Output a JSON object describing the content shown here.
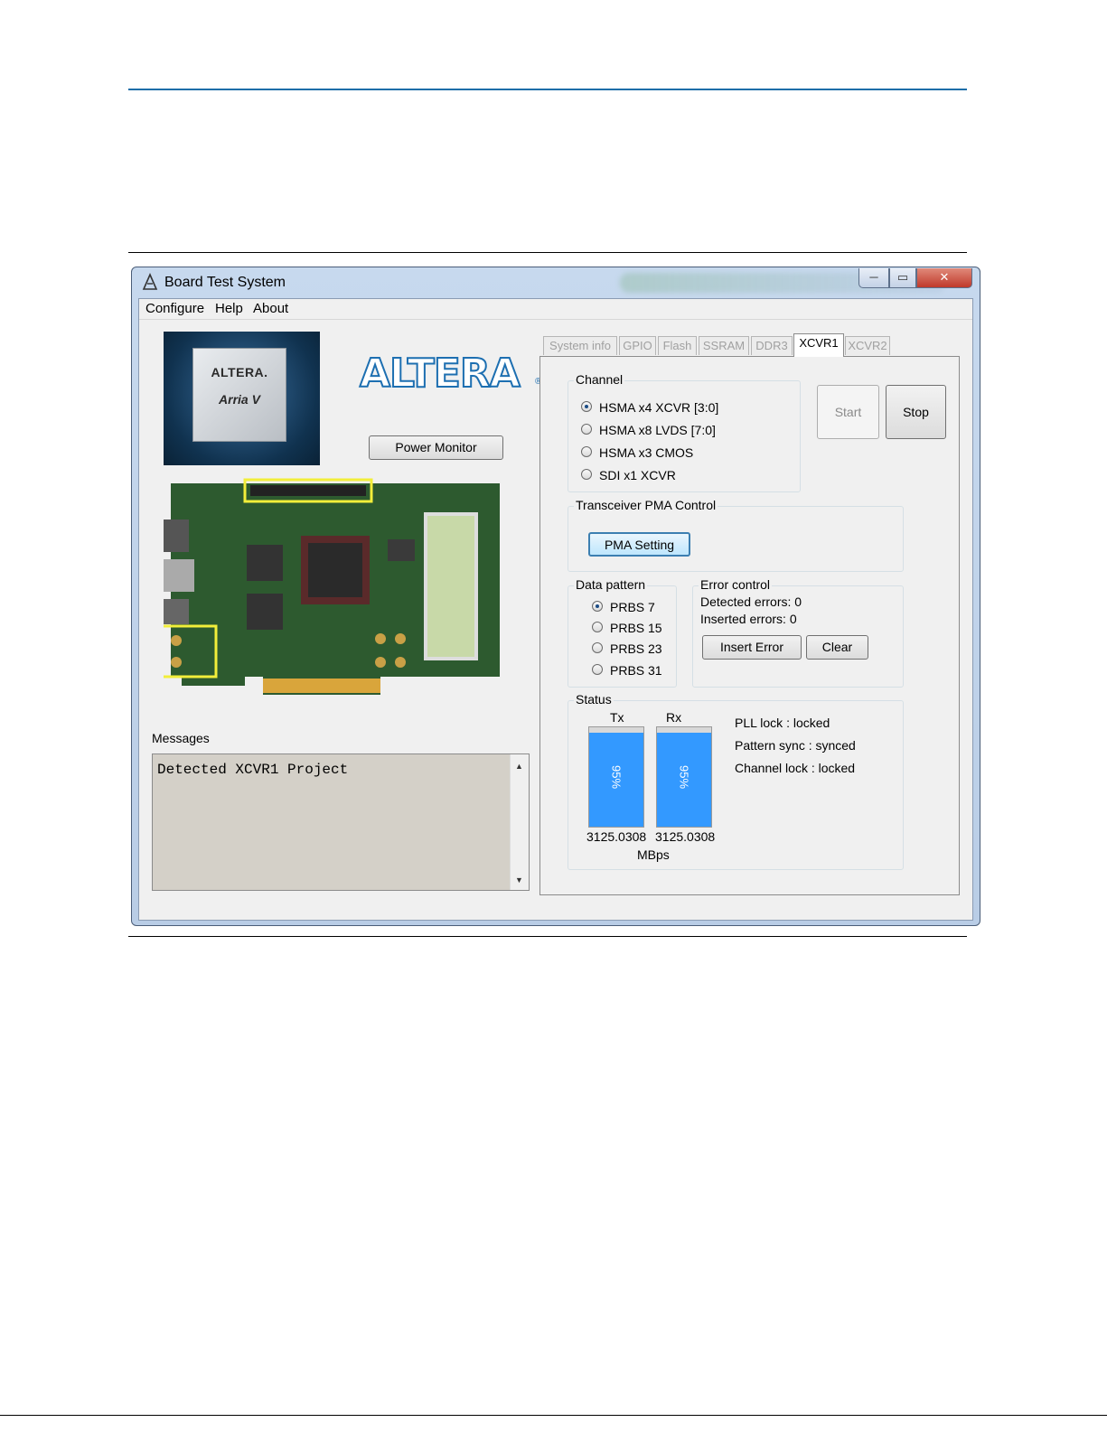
{
  "window": {
    "title": "Board Test System",
    "min_symbol": "─",
    "max_symbol": "▭",
    "close_symbol": "✕"
  },
  "menu": [
    "Configure",
    "Help",
    "About"
  ],
  "left": {
    "chip_brand": "ALTERA.",
    "chip_name": "Arria V",
    "logo_text": "ALTERA",
    "logo_reg": "®",
    "power_monitor_label": "Power Monitor",
    "messages_label": "Messages",
    "message_text": "Detected XCVR1 Project"
  },
  "tabs": [
    {
      "label": "System info",
      "active": false
    },
    {
      "label": "GPIO",
      "active": false
    },
    {
      "label": "Flash",
      "active": false
    },
    {
      "label": "SSRAM",
      "active": false
    },
    {
      "label": "DDR3",
      "active": false
    },
    {
      "label": "XCVR1",
      "active": true
    },
    {
      "label": "XCVR2",
      "active": false
    }
  ],
  "channel": {
    "title": "Channel",
    "options": [
      "HSMA x4 XCVR [3:0]",
      "HSMA x8 LVDS [7:0]",
      "HSMA x3 CMOS",
      "SDI x1 XCVR"
    ],
    "selected": 0
  },
  "controls": {
    "start_label": "Start",
    "stop_label": "Stop"
  },
  "pma": {
    "title": "Transceiver PMA Control",
    "button_label": "PMA Setting"
  },
  "data_pattern": {
    "title": "Data pattern",
    "options": [
      "PRBS 7",
      "PRBS 15",
      "PRBS 23",
      "PRBS 31"
    ],
    "selected": 0
  },
  "error_control": {
    "title": "Error control",
    "detected": "Detected errors: 0",
    "inserted": "Inserted errors: 0",
    "insert_label": "Insert Error",
    "clear_label": "Clear"
  },
  "status": {
    "title": "Status",
    "tx_label": "Tx",
    "rx_label": "Rx",
    "tx_percent": 95,
    "rx_percent": 95,
    "tx_pct_text": "95%",
    "rx_pct_text": "95%",
    "tx_rate": "3125.0308",
    "rx_rate": "3125.0308",
    "unit": "MBps",
    "pll_lock": "PLL lock : locked",
    "pattern_sync": "Pattern sync : synced",
    "channel_lock": "Channel lock : locked"
  }
}
